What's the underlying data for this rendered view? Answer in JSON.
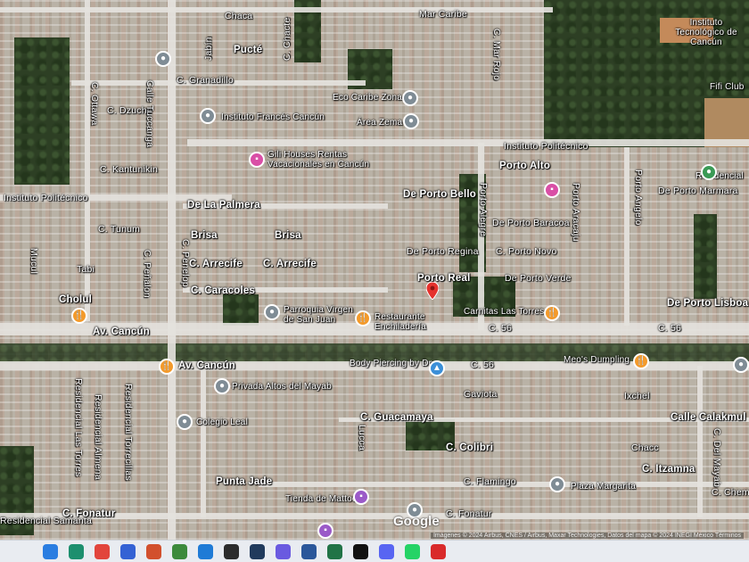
{
  "map": {
    "street_labels": [
      {
        "id": "chaca",
        "text": "Chaca"
      },
      {
        "id": "mar-caribe",
        "text": "Mar Caribe"
      },
      {
        "id": "pucte",
        "text": "Pucté"
      },
      {
        "id": "jabin",
        "text": "Jabín"
      },
      {
        "id": "c-chacte",
        "text": "C. Chacte"
      },
      {
        "id": "c-mar-rojo",
        "text": "C. Mar Rojo"
      },
      {
        "id": "c-granadillo",
        "text": "C. Granadillo"
      },
      {
        "id": "c-dzuche",
        "text": "C. Dzuche"
      },
      {
        "id": "c-kantunikin",
        "text": "C. Kantunikin"
      },
      {
        "id": "instituto-politecnico-w",
        "text": "Instituto Politécnico"
      },
      {
        "id": "instituto-politecnico-e",
        "text": "Instituto Politécnico"
      },
      {
        "id": "porto-alto",
        "text": "Porto Alto"
      },
      {
        "id": "de-porto-bello",
        "text": "De Porto Bello"
      },
      {
        "id": "de-porto-marmara",
        "text": "De Porto Marmara"
      },
      {
        "id": "de-la-palmera",
        "text": "De La Palmera"
      },
      {
        "id": "c-tunum",
        "text": "C. Tunum"
      },
      {
        "id": "brisa-1",
        "text": "Brisa"
      },
      {
        "id": "brisa-2",
        "text": "Brisa"
      },
      {
        "id": "c-arrecife-1",
        "text": "C. Arrecife"
      },
      {
        "id": "c-arrecife-2",
        "text": "C. Arrecife"
      },
      {
        "id": "c-caracoles",
        "text": "C. Caracoles"
      },
      {
        "id": "porto-real",
        "text": "Porto Real"
      },
      {
        "id": "de-porto-regina",
        "text": "De Porto Regina"
      },
      {
        "id": "de-porto-baracoa",
        "text": "De Porto Baracoa"
      },
      {
        "id": "c-porto-novo",
        "text": "C. Porto Novo"
      },
      {
        "id": "de-porto-verde",
        "text": "De Porto Verde"
      },
      {
        "id": "de-porto-lisboa",
        "text": "De Porto Lisboa"
      },
      {
        "id": "cholul",
        "text": "Cholul"
      },
      {
        "id": "av-cancun-1",
        "text": "Av. Cancún"
      },
      {
        "id": "av-cancun-2",
        "text": "Av. Cancún"
      },
      {
        "id": "c-56-a",
        "text": "C. 56"
      },
      {
        "id": "c-56-b",
        "text": "C. 56"
      },
      {
        "id": "c-56-c",
        "text": "C. 56"
      },
      {
        "id": "c-calakmul",
        "text": "Calle Calakmul"
      },
      {
        "id": "ixchel",
        "text": "Ixchel"
      },
      {
        "id": "c-guacamaya",
        "text": "C. Guacamaya"
      },
      {
        "id": "gaviota",
        "text": "Gaviota"
      },
      {
        "id": "chacc",
        "text": "Chacc"
      },
      {
        "id": "c-colibri",
        "text": "C. Colibri"
      },
      {
        "id": "c-itzamna",
        "text": "C. Itzamna"
      },
      {
        "id": "c-flamingo",
        "text": "C. Flamingo"
      },
      {
        "id": "punta-jade",
        "text": "Punta Jade"
      },
      {
        "id": "c-fonatur-w",
        "text": "C. Fonatur"
      },
      {
        "id": "c-fonatur-e",
        "text": "C. Fonatur"
      },
      {
        "id": "residencial-las-torres",
        "text": "Residencial Las Torres"
      },
      {
        "id": "residencial-almena",
        "text": "Residencial Almena"
      },
      {
        "id": "residencial-torrecillas",
        "text": "Residencial Torrecillas"
      },
      {
        "id": "calle-tuccanga",
        "text": "Calle Tuccanga"
      },
      {
        "id": "porto-alegre",
        "text": "Porto Alegre"
      },
      {
        "id": "porto-aracaju",
        "text": "Porto Aracaju"
      },
      {
        "id": "porto-angelo",
        "text": "Porto Angelo"
      },
      {
        "id": "c-s-ottawa",
        "text": "C. Ottawa"
      },
      {
        "id": "tabi",
        "text": "Tabi"
      },
      {
        "id": "mucul",
        "text": "Mucul"
      },
      {
        "id": "c-del-mayab",
        "text": "C. Del Mayab"
      },
      {
        "id": "c-chemuil",
        "text": "C. Chemuil"
      },
      {
        "id": "c-penelop",
        "text": "C. Penelop"
      },
      {
        "id": "c-penalon",
        "text": "C. Peñalon"
      },
      {
        "id": "residencial-samantha",
        "text": "Residencial Samanta"
      },
      {
        "id": "lucca",
        "text": "Lucca"
      }
    ],
    "poi_labels": [
      {
        "id": "instituto-tecnologico",
        "text": "Instituto Tecnológico de Cancún"
      },
      {
        "id": "instituto-frances",
        "text": "Instituto Francés Cancún"
      },
      {
        "id": "eco-caribe",
        "text": "Eco Caribe Zona"
      },
      {
        "id": "area-zema",
        "text": "Área Zema"
      },
      {
        "id": "gili-houses",
        "text": "Gili Houses Rentas Vacacionales en Cancún"
      },
      {
        "id": "parroquia",
        "text": "Parroquia Virgen de San Juan"
      },
      {
        "id": "enchiladeria",
        "text": "Restaurante Enchiladería"
      },
      {
        "id": "carnitas",
        "text": "Carnitas Las Torres"
      },
      {
        "id": "body-piercing",
        "text": "Body Piercing by Dr"
      },
      {
        "id": "meos-dumpling",
        "text": "Meo's Dumpling"
      },
      {
        "id": "privada-altos",
        "text": "Privada Altos del Mayab"
      },
      {
        "id": "colegio",
        "text": "Colegio Leal"
      },
      {
        "id": "plaza-margarita",
        "text": "Plaza Margarita"
      },
      {
        "id": "tienda-mattocs",
        "text": "Tienda de Mattocs"
      },
      {
        "id": "residencial-sb",
        "text": "Residencial"
      },
      {
        "id": "fifi-club",
        "text": "Fifi Club"
      }
    ],
    "google_logo": "Google",
    "attribution": "Imágenes © 2024 Airbus, CNES / Airbus, Maxar Technologies, Datos del mapa © 2024 INEGI    México    Términos"
  },
  "taskbar": {
    "apps": [
      {
        "id": "start",
        "icon": "windows-start-icon",
        "color": "#2a7de1"
      },
      {
        "id": "edge",
        "icon": "edge-icon",
        "color": "#1d8f6e"
      },
      {
        "id": "chrome",
        "icon": "chrome-icon",
        "color": "#e2453c"
      },
      {
        "id": "store",
        "icon": "store-icon",
        "color": "#3462d4"
      },
      {
        "id": "powerpoint",
        "icon": "powerpoint-icon",
        "color": "#d2502d"
      },
      {
        "id": "minecraft",
        "icon": "minecraft-icon",
        "color": "#3c8a3c"
      },
      {
        "id": "paint",
        "icon": "paint-icon",
        "color": "#1f7bd6"
      },
      {
        "id": "obs",
        "icon": "obs-icon",
        "color": "#2c2c2c"
      },
      {
        "id": "steam",
        "icon": "steam-icon",
        "color": "#203a5c"
      },
      {
        "id": "copilot",
        "icon": "copilot-icon",
        "color": "#6a5ae0"
      },
      {
        "id": "word",
        "icon": "word-icon",
        "color": "#2b579a"
      },
      {
        "id": "excel",
        "icon": "excel-icon",
        "color": "#217346"
      },
      {
        "id": "tiktok",
        "icon": "tiktok-icon",
        "color": "#111111"
      },
      {
        "id": "discord",
        "icon": "discord-icon",
        "color": "#5865f2"
      },
      {
        "id": "whatsapp",
        "icon": "whatsapp-icon",
        "color": "#25d366"
      },
      {
        "id": "acrobat",
        "icon": "acrobat-icon",
        "color": "#d92a2a"
      }
    ]
  }
}
